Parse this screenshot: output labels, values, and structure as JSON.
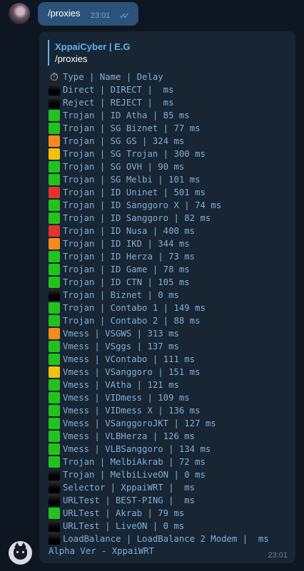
{
  "outgoing": {
    "text": "/proxies",
    "time": "23:01",
    "status": "read"
  },
  "incoming": {
    "reply_to": {
      "author": "XppaiCyber | E.G",
      "text": "/proxies"
    },
    "header": "Type | Name | Delay",
    "rows": [
      {
        "text": "Direct | DIRECT |  ms",
        "status": "none"
      },
      {
        "text": "Reject | REJECT |  ms",
        "status": "none"
      },
      {
        "text": "Trojan | ID Atha | 85 ms",
        "status": "good"
      },
      {
        "text": "Trojan | SG Biznet | 77 ms",
        "status": "good"
      },
      {
        "text": "Trojan | SG GS | 324 ms",
        "status": "slow"
      },
      {
        "text": "Trojan | SG Trojan | 300 ms",
        "status": "medium"
      },
      {
        "text": "Trojan | SG OVH | 90 ms",
        "status": "good"
      },
      {
        "text": "Trojan | SG Melbi | 101 ms",
        "status": "good"
      },
      {
        "text": "Trojan | ID Uninet | 501 ms",
        "status": "bad"
      },
      {
        "text": "Trojan | ID Sanggoro X | 74 ms",
        "status": "good"
      },
      {
        "text": "Trojan | ID Sanggoro | 82 ms",
        "status": "good"
      },
      {
        "text": "Trojan | ID Nusa | 400 ms",
        "status": "bad"
      },
      {
        "text": "Trojan | ID IKD | 344 ms",
        "status": "slow"
      },
      {
        "text": "Trojan | ID Herza | 73 ms",
        "status": "good"
      },
      {
        "text": "Trojan | ID Game | 78 ms",
        "status": "good"
      },
      {
        "text": "Trojan | ID CTN | 105 ms",
        "status": "good"
      },
      {
        "text": "Trojan | Biznet | 0 ms",
        "status": "none"
      },
      {
        "text": "Trojan | Contabo 1 | 149 ms",
        "status": "good"
      },
      {
        "text": "Trojan | Contabo 2 | 88 ms",
        "status": "good"
      },
      {
        "text": "Vmess | VSGWS | 313 ms",
        "status": "slow"
      },
      {
        "text": "Vmess | VSggs | 137 ms",
        "status": "good"
      },
      {
        "text": "Vmess | VContabo | 111 ms",
        "status": "good"
      },
      {
        "text": "Vmess | VSanggoro | 151 ms",
        "status": "medium"
      },
      {
        "text": "Vmess | VAtha | 121 ms",
        "status": "good"
      },
      {
        "text": "Vmess | VIDmess | 109 ms",
        "status": "good"
      },
      {
        "text": "Vmess | VIDmess X | 136 ms",
        "status": "good"
      },
      {
        "text": "Vmess | VSanggoroJKT | 127 ms",
        "status": "good"
      },
      {
        "text": "Vmess | VLBHerza | 126 ms",
        "status": "good"
      },
      {
        "text": "Vmess | VLBSanggoro | 134 ms",
        "status": "good"
      },
      {
        "text": "Trojan | MelbiAkrab | 72 ms",
        "status": "good"
      },
      {
        "text": "Trojan | MelbiLiveON | 0 ms",
        "status": "none"
      },
      {
        "text": "Selector | XppaiWRT |  ms",
        "status": "none"
      },
      {
        "text": "URLTest | BEST-PING |  ms",
        "status": "none"
      },
      {
        "text": "URLTest | Akrab | 79 ms",
        "status": "good"
      },
      {
        "text": "URLTest | LiveON | 0 ms",
        "status": "none"
      },
      {
        "text": "LoadBalance | LoadBalance 2 Modem |  ms",
        "status": "none"
      }
    ],
    "footer": "Alpha Ver - XppaiWRT",
    "time": "23:01"
  },
  "status_colors": {
    "good": "#22c21e",
    "medium": "#f2c00f",
    "slow": "#f78a1d",
    "bad": "#e0352a",
    "none": "#050505"
  },
  "icons": {
    "header": "stopwatch-icon",
    "row": "status-square-icon",
    "bot": "black-cat-icon"
  }
}
